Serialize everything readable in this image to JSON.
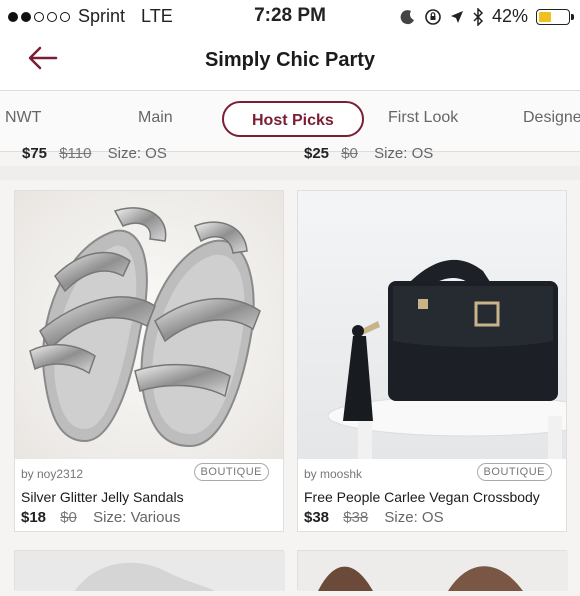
{
  "status_bar": {
    "carrier": "Sprint",
    "network": "LTE",
    "time": "7:28 PM",
    "battery": "42%",
    "battery_level": 0.42
  },
  "header": {
    "title": "Simply Chic Party"
  },
  "tabs": [
    {
      "label": "NWT"
    },
    {
      "label": "Main"
    },
    {
      "label": "Host Picks",
      "active": true
    },
    {
      "label": "First Look"
    },
    {
      "label": "Designe"
    }
  ],
  "previous_row": [
    {
      "price": "$75",
      "original": "$110",
      "size": "Size: OS"
    },
    {
      "price": "$25",
      "original": "$0",
      "size": "Size: OS"
    }
  ],
  "listings": [
    {
      "seller": "by noy2312",
      "badge": "BOUTIQUE",
      "title": "Silver Glitter Jelly Sandals",
      "price": "$18",
      "original": "$0",
      "size": "Size: Various"
    },
    {
      "seller": "by mooshk",
      "badge": "BOUTIQUE",
      "title": "Free People Carlee Vegan Crossbody",
      "price": "$38",
      "original": "$38",
      "size": "Size: OS"
    }
  ],
  "colors": {
    "accent": "#7a1e33",
    "battery": "#f0c020"
  }
}
